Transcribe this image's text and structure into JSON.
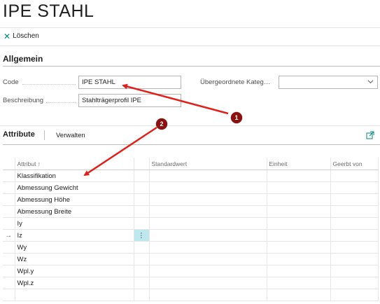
{
  "page": {
    "title": "IPE STAHL"
  },
  "actions": {
    "delete_label": "Löschen"
  },
  "general": {
    "section_title": "Allgemein",
    "code_label": "Code",
    "code_value": "IPE STAHL",
    "description_label": "Beschreibung",
    "description_value": "Stahlträgerprofil IPE",
    "parent_label": "Übergeordnete Kateg…",
    "parent_value": ""
  },
  "attributes": {
    "tab_title": "Attribute",
    "manage_label": "Verwalten",
    "columns": {
      "attribute": "Attribut ↑",
      "default": "Standardwert",
      "unit": "Einheit",
      "inherited": "Geerbt von"
    },
    "rows": [
      {
        "name": "Klassifikation",
        "default": "",
        "unit": "",
        "inherited": ""
      },
      {
        "name": "Abmessung Gewicht",
        "default": "",
        "unit": "",
        "inherited": ""
      },
      {
        "name": "Abmessung Höhe",
        "default": "",
        "unit": "",
        "inherited": ""
      },
      {
        "name": "Abmessung Breite",
        "default": "",
        "unit": "",
        "inherited": ""
      },
      {
        "name": "Iy",
        "default": "",
        "unit": "",
        "inherited": ""
      },
      {
        "name": "Iz",
        "default": "",
        "unit": "",
        "inherited": "",
        "current": true
      },
      {
        "name": "Wy",
        "default": "",
        "unit": "",
        "inherited": ""
      },
      {
        "name": "Wz",
        "default": "",
        "unit": "",
        "inherited": ""
      },
      {
        "name": "Wpl.y",
        "default": "",
        "unit": "",
        "inherited": ""
      },
      {
        "name": "Wpl.z",
        "default": "",
        "unit": "",
        "inherited": ""
      },
      {
        "name": "",
        "default": "",
        "unit": "",
        "inherited": ""
      }
    ],
    "row_menu_glyph": "⋮",
    "current_row_glyph": "→"
  },
  "annotations": {
    "badge_1": "1",
    "badge_2": "2",
    "badge_color": "#8b1010",
    "arrow_color": "#e0201b"
  },
  "icons": {
    "delete": "close-icon",
    "share": "share-icon",
    "chevron": "chevron-down-icon"
  },
  "colors": {
    "accent": "#00897b",
    "selected_cell": "#bfe7ee"
  }
}
